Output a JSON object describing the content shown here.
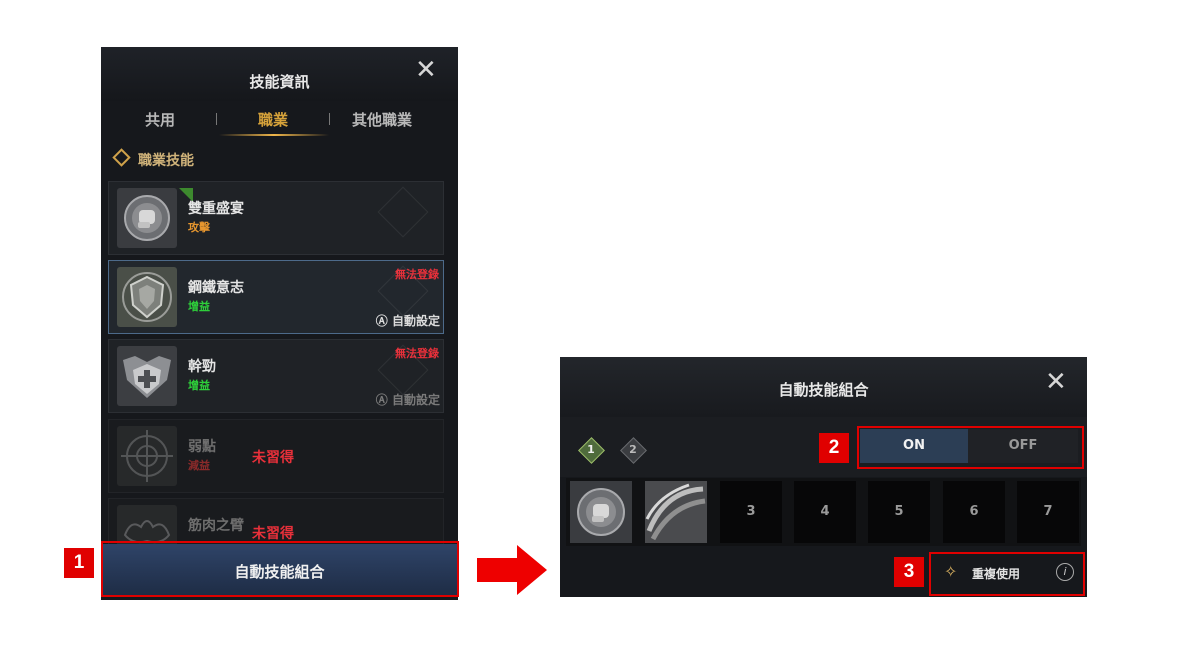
{
  "skill_window": {
    "title": "技能資訊",
    "close_icon": "close-icon",
    "tabs": [
      {
        "label": "共用",
        "active": false
      },
      {
        "label": "職業",
        "active": true
      },
      {
        "label": "其他職業",
        "active": false
      }
    ],
    "section_title": "職業技能",
    "skills": [
      {
        "name": "雙重盛宴",
        "type": "攻擊",
        "type_color": "#e6962e",
        "icon": "fist-icon",
        "warning": "",
        "auto_label": "",
        "status": ""
      },
      {
        "name": "鋼鐵意志",
        "type": "增益",
        "type_color": "#2ecf3a",
        "icon": "shield-icon",
        "warning": "無法登錄",
        "auto_label": "自動設定",
        "status": ""
      },
      {
        "name": "幹勁",
        "type": "增益",
        "type_color": "#2ecf3a",
        "icon": "cross-shield-icon",
        "warning": "無法登錄",
        "auto_label": "自動設定",
        "status": ""
      },
      {
        "name": "弱點",
        "type": "減益",
        "type_color": "#8a2a2a",
        "icon": "target-icon",
        "warning": "",
        "auto_label": "",
        "status": "未習得"
      },
      {
        "name": "筋肉之臂",
        "type": "",
        "type_color": "#8a2a2a",
        "icon": "arm-icon",
        "warning": "",
        "auto_label": "",
        "status": "未習得"
      }
    ],
    "auto_combo_button": "自動技能組合"
  },
  "step_badges": [
    "1",
    "2",
    "3"
  ],
  "arrow_icon": "right-arrow-icon",
  "combo_window": {
    "title": "自動技能組合",
    "close_icon": "close-icon",
    "sets": [
      "1",
      "2"
    ],
    "toggle": {
      "on_label": "ON",
      "off_label": "OFF",
      "selected": "ON"
    },
    "slots": [
      {
        "label": "",
        "icon": "fist-icon"
      },
      {
        "label": "",
        "icon": "swirl-icon"
      },
      {
        "label": "3",
        "icon": ""
      },
      {
        "label": "4",
        "icon": ""
      },
      {
        "label": "5",
        "icon": ""
      },
      {
        "label": "6",
        "icon": ""
      },
      {
        "label": "7",
        "icon": ""
      }
    ],
    "repeat_label": "重複使用",
    "info_icon": "info-icon"
  },
  "colors": {
    "highlight_red": "#e00000",
    "active_tab": "#d6a23a",
    "toggle_on_bg": "#2c3e55"
  }
}
